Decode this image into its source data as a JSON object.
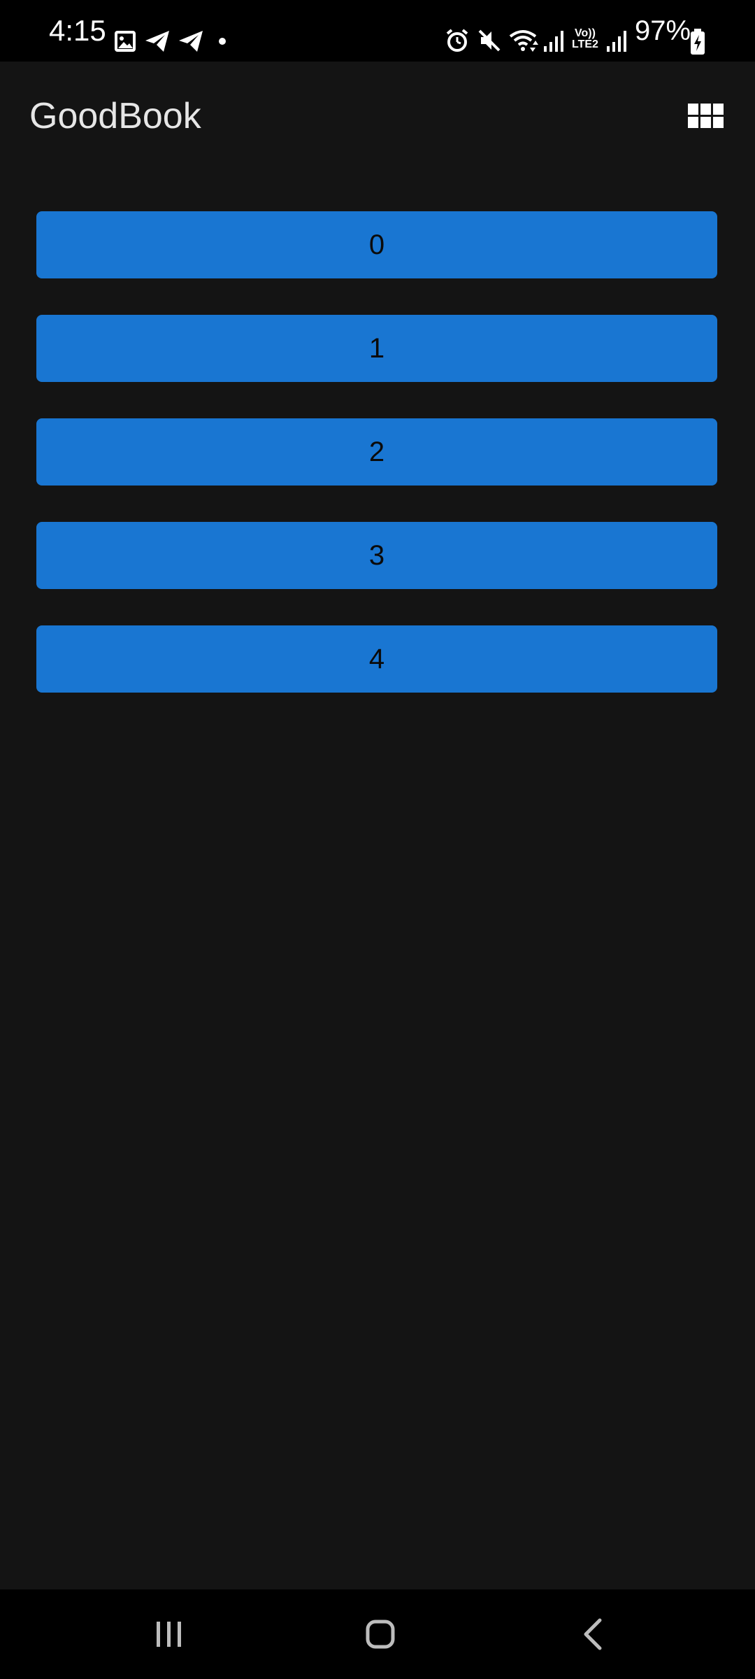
{
  "status_bar": {
    "time": "4:15",
    "battery": "97%",
    "network_top": "Vo))",
    "network_bottom": "LTE2",
    "left_icons": [
      "image-icon",
      "telegram-icon",
      "telegram-icon",
      "dot-icon"
    ],
    "right_icons": [
      "alarm-icon",
      "mute-icon",
      "wifi-icon",
      "signal-icon",
      "signal-icon",
      "battery-charging-icon"
    ]
  },
  "app_bar": {
    "title": "GoodBook",
    "menu_icon": "grid-icon"
  },
  "buttons": [
    {
      "label": "0"
    },
    {
      "label": "1"
    },
    {
      "label": "2"
    },
    {
      "label": "3"
    },
    {
      "label": "4"
    }
  ],
  "nav_bar": {
    "icons": [
      "recents-icon",
      "home-icon",
      "back-icon"
    ]
  },
  "colors": {
    "background": "#141414",
    "button": "#1976d2",
    "status_bar": "#000000",
    "title": "#e6e6e6"
  }
}
